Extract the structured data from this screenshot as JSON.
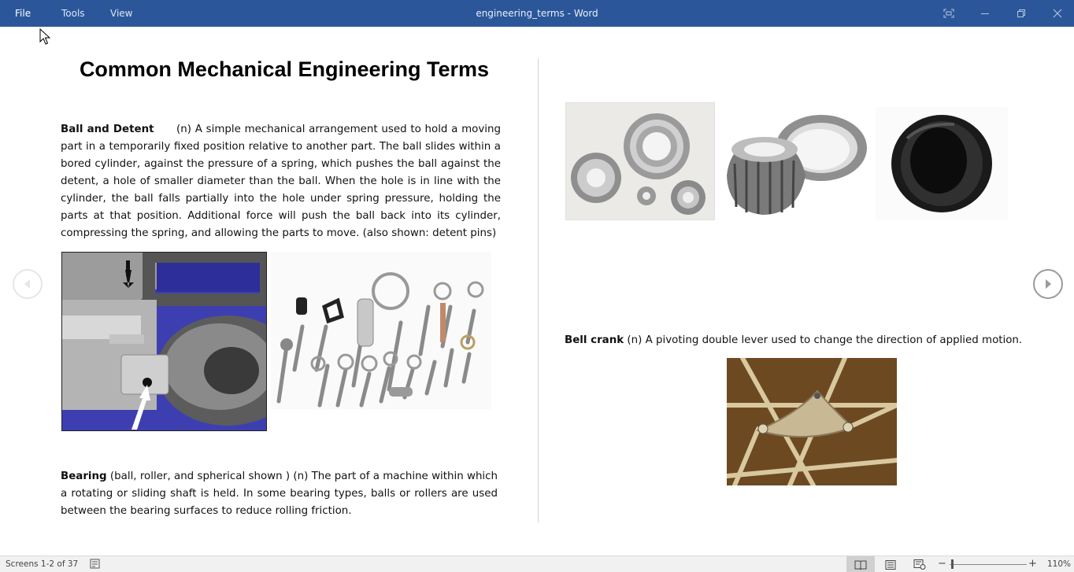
{
  "window": {
    "title": "engineering_terms - Word",
    "menu": {
      "file": "File",
      "tools": "Tools",
      "view": "View"
    }
  },
  "document": {
    "heading": "Common Mechanical Engineering Terms",
    "ball_detent": {
      "term": "Ball and Detent",
      "body": "      (n)  A simple mechanical arrangement used to hold a moving part in a temporarily fixed position relative to another part.  The ball slides within a bored cylinder, against the pressure of a spring, which pushes the ball against the detent, a hole of smaller diameter than the ball.  When the hole is in line with the cylinder, the ball falls partially into the hole under spring pressure, holding the parts at that position. Additional force will push the ball back into its cylinder, compressing the spring, and allowing the parts to move. (also shown: detent pins)"
    },
    "bearing": {
      "term": "Bearing",
      "body": " (ball, roller, and spherical shown )  (n)  The part of a machine within which a rotating or sliding shaft is held.  In some bearing types, balls or rollers are used between the bearing surfaces to reduce rolling friction."
    },
    "bell_crank": {
      "term": "Bell crank",
      "body": " (n)  A pivoting double lever used to change the direction of applied motion."
    }
  },
  "status": {
    "pages": "Screens 1-2 of 37",
    "zoom": "110%",
    "zoom_fraction": 0.02
  },
  "icons": {
    "maximize": "focus-mode-icon",
    "minimize": "minimize-icon",
    "restore": "restore-icon",
    "close": "close-icon",
    "prev": "chevron-left-icon",
    "next": "chevron-right-icon"
  },
  "colors": {
    "titlebar": "#2b579a",
    "statusbar": "#f1f1f1"
  }
}
